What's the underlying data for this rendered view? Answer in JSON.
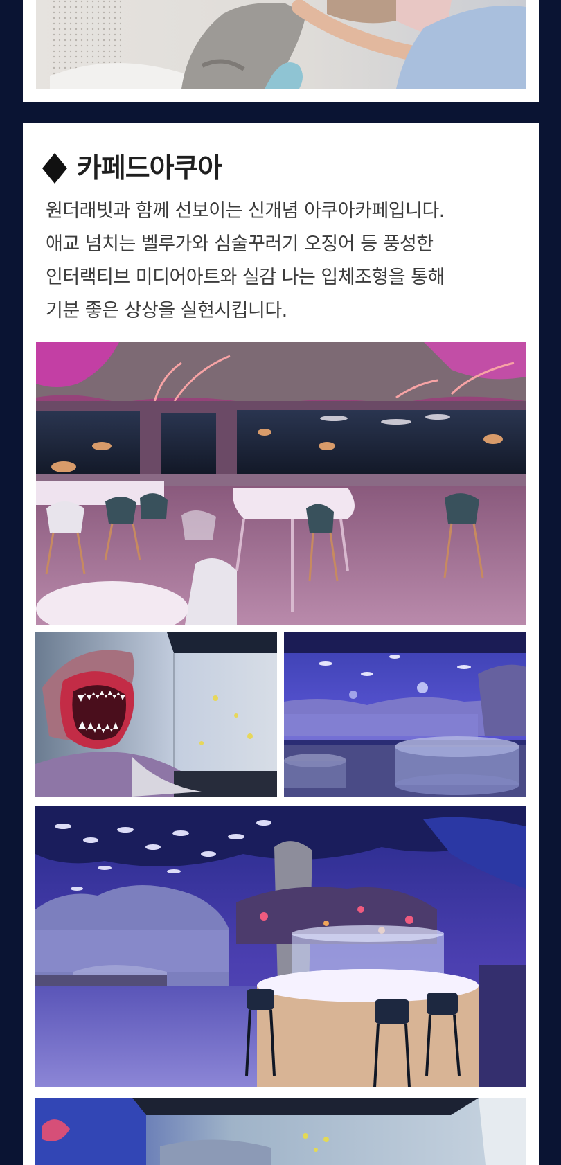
{
  "section": {
    "title": "카페드아쿠아",
    "description_lines": [
      "원더래빗과 함께 선보이는 신개념 아쿠아카페입니다.",
      "애교 넘치는 벨루가와 심술꾸러기 오징어 등 풍성한",
      "인터랙티브 미디어아트와 실감 나는 입체조형을 통해",
      "기분 좋은 상상을 실현시킵니다."
    ]
  },
  "icons": {
    "title_marker": "diamond-icon"
  },
  "colors": {
    "page_background": "#0a1433",
    "card_background": "#ffffff",
    "title_text": "#1f1f1f",
    "body_text": "#3c3c3c"
  }
}
